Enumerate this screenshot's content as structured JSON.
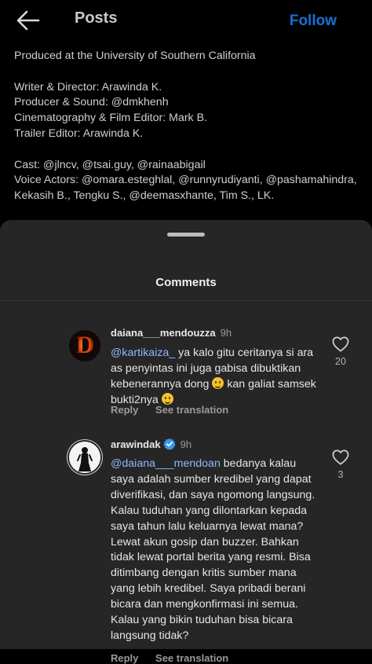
{
  "header": {
    "title": "Posts",
    "follow_label": "Follow",
    "back_icon": "arrow-left-icon"
  },
  "caption": {
    "lines": [
      "Produced at the University of Southern California",
      "",
      "Writer & Director: Arawinda K.",
      "Producer & Sound: @dmkhenh",
      "Cinematography & Film Editor: Mark B.",
      "Trailer Editor: Arawinda K.",
      "",
      "Cast: @jlncv, @tsai.guy, @rainaabigail",
      "Voice Actors: @omara.esteghlal, @runnyrudiyanti, @pashamahindra,",
      "Kekasih B., Tengku S., @deemasxhante, Tim S., LK."
    ]
  },
  "comments_sheet": {
    "title": "Comments",
    "comments": [
      {
        "username": "daiana___mendouzza",
        "time": "9h",
        "mention": "@kartikaiza_",
        "text_a": " ya kalo gitu ceritanya si ara as penyintas ini juga gabisa dibuktikan kebenerannya dong ",
        "text_b": " kan galiat samsek bukti2nya ",
        "likes": "20",
        "reply_label": "Reply",
        "translate_label": "See translation",
        "avatar_letter": "D"
      },
      {
        "username": "arawindak",
        "time": "9h",
        "mention": "@daiana___mendoan",
        "text": " bedanya kalau saya adalah sumber kredibel yang dapat diverifikasi, dan saya ngomong langsung. Kalau tuduhan yang dilontarkan kepada saya tahun lalu keluarnya lewat mana? Lewat akun gosip dan buzzer. Bahkan tidak lewat portal berita yang resmi. Bisa ditimbang dengan kritis sumber mana yang lebih kredibel. Saya pribadi berani bicara dan mengkonfirmasi ini semua. Kalau yang bikin tuduhan bisa bicara langsung tidak?",
        "likes": "3",
        "reply_label": "Reply",
        "translate_label": "See translation"
      }
    ]
  },
  "colors": {
    "accent": "#1a6fd4",
    "mention": "#8fb7ff",
    "sheet_bg": "#262626",
    "page_bg": "#000000"
  }
}
